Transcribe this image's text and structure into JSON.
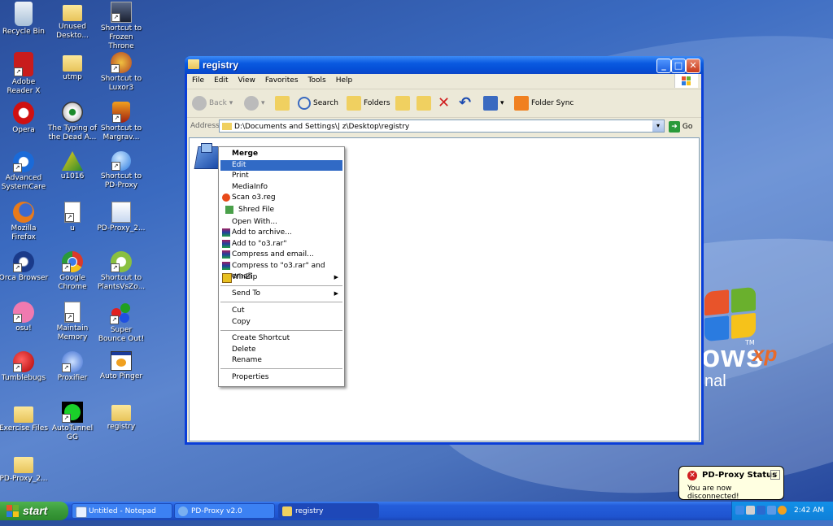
{
  "desktop": {
    "icons": [
      {
        "label": "Recycle Bin"
      },
      {
        "label": "Unused Deskto..."
      },
      {
        "label": "Shortcut to Frozen Throne"
      },
      {
        "label": "Adobe Reader X"
      },
      {
        "label": "utmp"
      },
      {
        "label": "Shortcut to Luxor3"
      },
      {
        "label": "Opera"
      },
      {
        "label": "The Typing of the Dead A..."
      },
      {
        "label": "Shortcut to Margrav..."
      },
      {
        "label": "Advanced SystemCare"
      },
      {
        "label": "u1016"
      },
      {
        "label": "Shortcut to PD-Proxy"
      },
      {
        "label": "Mozilla Firefox"
      },
      {
        "label": "u"
      },
      {
        "label": "PD-Proxy_2..."
      },
      {
        "label": "Orca Browser"
      },
      {
        "label": "Google Chrome"
      },
      {
        "label": "Shortcut to PlantsVsZo..."
      },
      {
        "label": "osu!"
      },
      {
        "label": "Maintain Memory"
      },
      {
        "label": "Super Bounce Out!"
      },
      {
        "label": "Tumblebugs"
      },
      {
        "label": "Proxifier"
      },
      {
        "label": "Auto Pinger"
      },
      {
        "label": "Exercise Files"
      },
      {
        "label": "AutoTunnel GG"
      },
      {
        "label": "registry"
      },
      {
        "label": "PD-Proxy_2..."
      }
    ],
    "wallpaper_text": {
      "brand": "ows",
      "suffix": "xp",
      "tm": "TM",
      "edition": "nal"
    }
  },
  "window": {
    "title": "registry",
    "menu": [
      "File",
      "Edit",
      "View",
      "Favorites",
      "Tools",
      "Help"
    ],
    "toolbar": {
      "back": "Back",
      "search": "Search",
      "folders": "Folders",
      "folder_sync": "Folder Sync"
    },
    "address": {
      "label": "Address",
      "value": "D:\\Documents and Settings\\|             z\\Desktop\\registry",
      "go": "Go"
    },
    "file": {
      "name": "o3"
    }
  },
  "context_menu": {
    "items": [
      "Merge",
      "Edit",
      "Print",
      "MediaInfo",
      "Scan o3.reg",
      "Shred File",
      "Open With...",
      "Add to archive...",
      "Add to \"o3.rar\"",
      "Compress and email...",
      "Compress to \"o3.rar\" and email",
      "WinZip",
      "Send To",
      "Cut",
      "Copy",
      "Create Shortcut",
      "Delete",
      "Rename",
      "Properties"
    ],
    "selected": "Edit"
  },
  "balloon": {
    "title": "PD-Proxy Status",
    "message": "You are now disconnected!"
  },
  "taskbar": {
    "start": "start",
    "tasks": [
      "Untitled - Notepad",
      "PD-Proxy v2.0",
      "registry"
    ],
    "clock": "2:42 AM"
  },
  "colors": {
    "selection": "#316ac5",
    "titlebar": "#0a5ae0",
    "start_green": "#3a9a3a"
  }
}
